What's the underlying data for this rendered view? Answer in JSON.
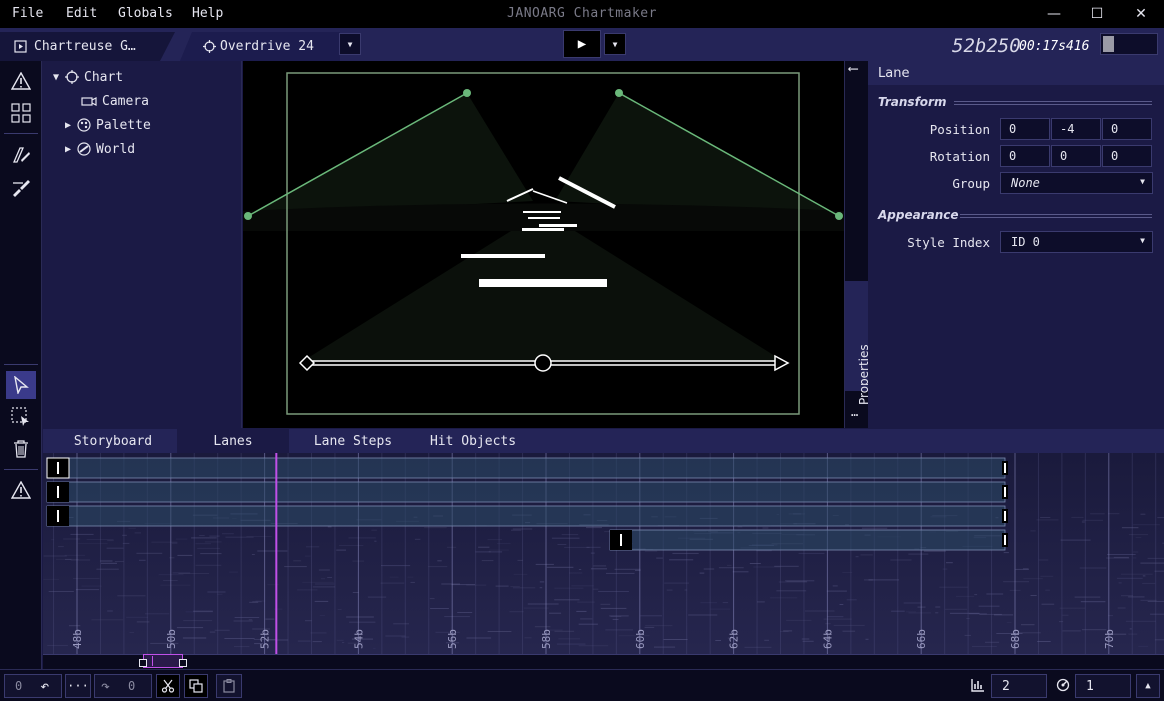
{
  "window": {
    "title": "JANOARG Chartmaker",
    "menu": [
      "File",
      "Edit",
      "Globals",
      "Help"
    ],
    "controls": {
      "minimize": "—",
      "maximize": "☐",
      "close": "✕"
    }
  },
  "tabs": [
    {
      "label": "Chartreuse G…"
    },
    {
      "label": "Overdrive 24"
    }
  ],
  "playback": {
    "play_symbol": "▶",
    "time_beats": "52b250",
    "time_seconds": "00:17s416",
    "volume": 0.2
  },
  "hierarchy": {
    "items": [
      {
        "label": "Chart",
        "expand": "▼",
        "icon": "chart-icon"
      },
      {
        "label": "Camera",
        "expand": "",
        "icon": "camera-icon"
      },
      {
        "label": "Palette",
        "expand": "▶",
        "icon": "palette-icon"
      },
      {
        "label": "World",
        "expand": "▶",
        "icon": "world-icon"
      }
    ]
  },
  "side_tab": {
    "label": "Properties",
    "back_arrow": "⟵",
    "more": "…"
  },
  "inspector": {
    "header": "Lane",
    "transform_title": "Transform",
    "position_label": "Position",
    "position": [
      "0",
      "-4",
      "0"
    ],
    "rotation_label": "Rotation",
    "rotation": [
      "0",
      "0",
      "0"
    ],
    "group_label": "Group",
    "group_value": "None",
    "appearance_title": "Appearance",
    "style_label": "Style Index",
    "style_value": "ID 0"
  },
  "timeline": {
    "tabs": [
      "Storyboard",
      "Lanes",
      "Lane Steps",
      "Hit Objects"
    ],
    "active_tab": "Lanes",
    "beat_labels": [
      "48b",
      "50b",
      "52b",
      "54b",
      "56b",
      "58b",
      "60b",
      "62b",
      "64b",
      "66b",
      "68b",
      "70b"
    ],
    "playhead_beat": 52.25
  },
  "bottom": {
    "undo_count": "0",
    "redo_count": "0",
    "more": "···",
    "undo_symbol": "↶",
    "redo_symbol": "↷",
    "beat_division": "2",
    "snap_value": "1",
    "collapse": "▲"
  },
  "colors": {
    "bg": "#1b1a45",
    "accent_purple": "#c050e8",
    "lane_green": "#6ab87a",
    "frame_green": "#7a9a7a"
  }
}
